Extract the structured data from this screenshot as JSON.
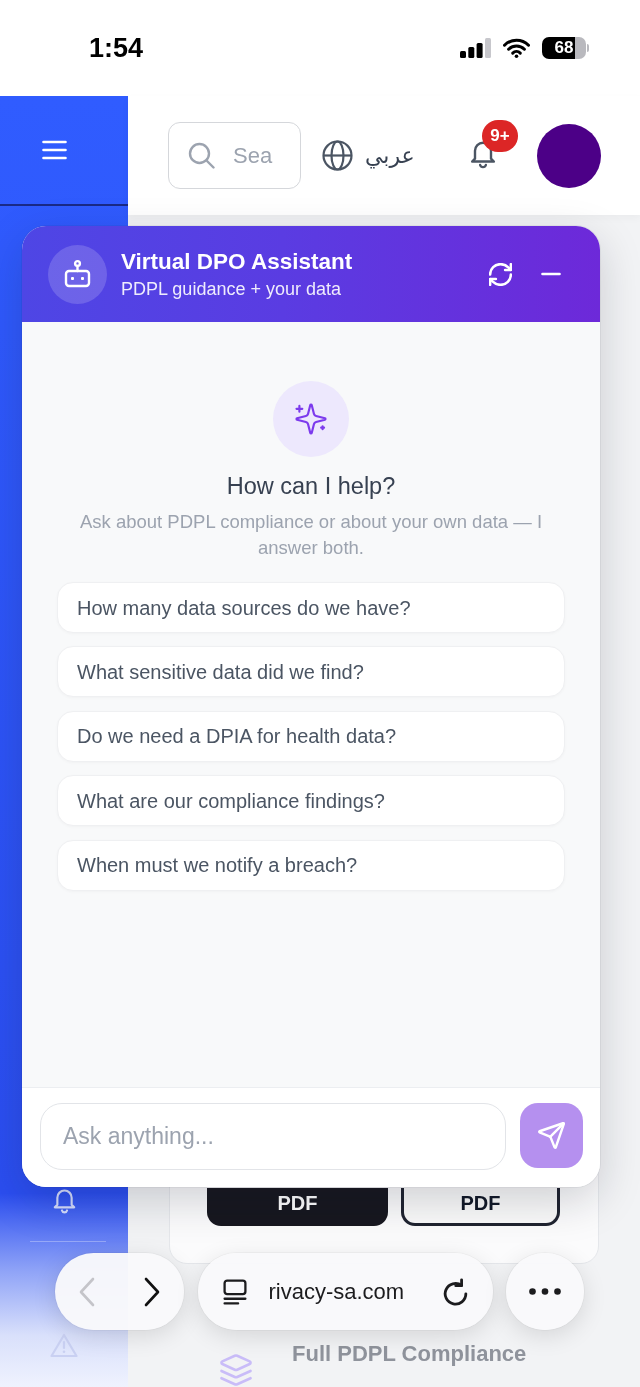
{
  "status_bar": {
    "time": "1:54",
    "battery": "68"
  },
  "header": {
    "search": {
      "placeholder": "Sea"
    },
    "language": "عربي",
    "notifications": {
      "badge": "9+"
    }
  },
  "page": {
    "card_buttons": [
      {
        "kind": "filled",
        "label": "PDF"
      },
      {
        "kind": "outlined",
        "label": "PDF"
      }
    ],
    "report_title": "Full PDPL Compliance"
  },
  "assistant": {
    "title": "Virtual DPO Assistant",
    "subtitle": "PDPL guidance + your data",
    "heading": "How can I help?",
    "intro": "Ask about PDPL compliance or about your own data — I answer both.",
    "suggestions": [
      "How many data sources do we have?",
      "What sensitive data did we find?",
      "Do we need a DPIA for health data?",
      "What are our compliance findings?",
      "When must we notify a breach?"
    ],
    "input": {
      "placeholder": "Ask anything..."
    },
    "send": {
      "disabled": true
    }
  },
  "browser_toolbar": {
    "back": {
      "disabled": true
    },
    "forward": {
      "disabled": false
    },
    "url": "rivacy-sa.com"
  }
}
